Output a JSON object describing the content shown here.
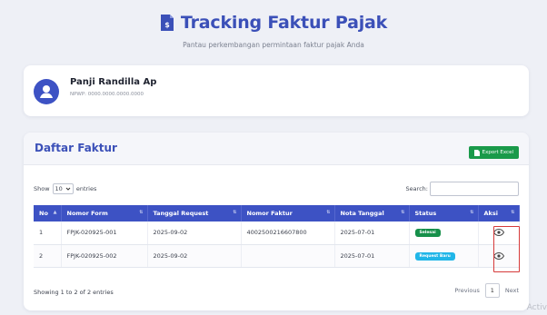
{
  "header": {
    "title": "Tracking Faktur Pajak",
    "subtitle": "Pantau perkembangan permintaan faktur pajak Anda",
    "icon": "receipt-icon"
  },
  "user": {
    "name": "Panji Randilla Ap",
    "npwp": "NPWP: 0000.0000.0000.0000",
    "avatar_icon": "user-icon"
  },
  "list": {
    "title": "Daftar Faktur",
    "export_label": "Export Excel",
    "show_label_before": "Show",
    "show_value": "10",
    "show_label_after": "entries",
    "search_label": "Search:",
    "search_value": "",
    "columns": [
      "No",
      "Nomor Form",
      "Tanggal Request",
      "Nomor Faktur",
      "Nota Tanggal",
      "Status",
      "Aksi"
    ],
    "rows": [
      {
        "no": "1",
        "nomor_form": "FPJK-020925-001",
        "tanggal_request": "2025-09-02",
        "nomor_faktur": "4002500216607800",
        "nota_tanggal": "2025-07-01",
        "status": "Selesai"
      },
      {
        "no": "2",
        "nomor_form": "FPJK-020925-002",
        "tanggal_request": "2025-09-02",
        "nomor_faktur": "",
        "nota_tanggal": "2025-07-01",
        "status": "Request Baru"
      }
    ],
    "info": "Showing 1 to 2 of 2 entries",
    "pagination": {
      "previous": "Previous",
      "current": "1",
      "next": "Next"
    }
  },
  "watermark": "Activ",
  "colors": {
    "primary": "#3d52c4",
    "success": "#16904a",
    "info": "#21b6e8",
    "export": "#1a9a4a",
    "highlight": "#d63a3a"
  }
}
